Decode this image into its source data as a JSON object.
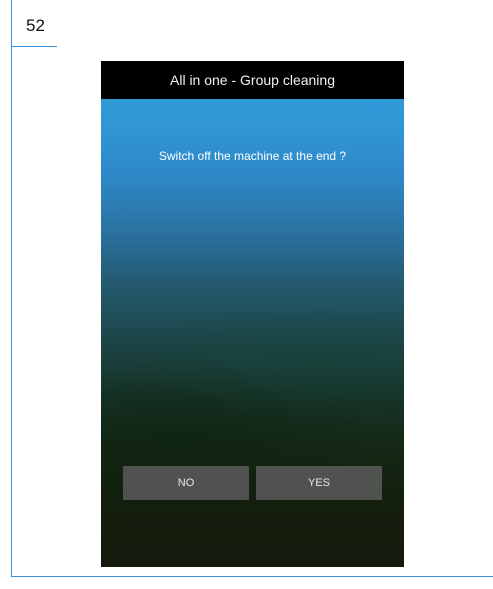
{
  "page": {
    "number": "52"
  },
  "screen": {
    "title": "All in one - Group cleaning",
    "prompt": "Switch off the machine at the end ?",
    "buttons": {
      "no_label": "NO",
      "yes_label": "YES"
    }
  },
  "colors": {
    "frame_border": "#3a8fd6",
    "titlebar_bg": "#000000",
    "button_bg": "#4f524f",
    "gradient_top": "#2e9fd9",
    "gradient_bottom": "#131a0c"
  }
}
